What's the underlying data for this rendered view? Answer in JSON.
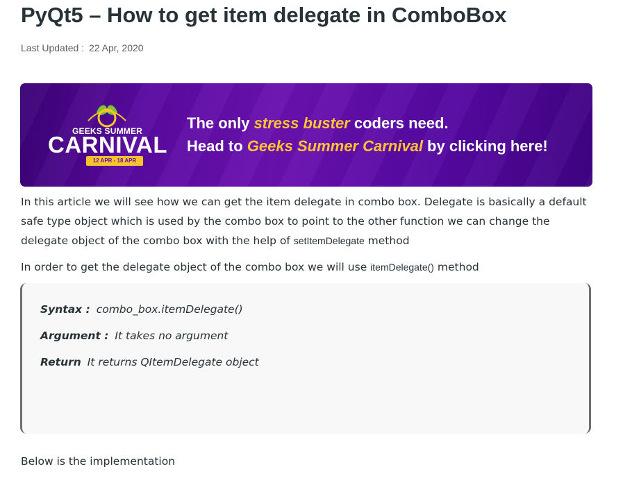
{
  "article": {
    "title": "PyQt5 – How to get item delegate in ComboBox",
    "last_updated_label": "Last Updated :",
    "last_updated_date": "22 Apr, 2020"
  },
  "banner": {
    "logo_top_text": "GEEKS SUMMER",
    "logo_main_text": "CARNIVAL",
    "logo_dates": "12 APR - 18 APR",
    "line1_prefix": "The only ",
    "line1_highlight": "stress buster",
    "line1_suffix": " coders need.",
    "line2_prefix": "Head to ",
    "line2_highlight": "Geeks Summer Carnival",
    "line2_suffix": " by clicking here!",
    "colors": {
      "background": "#5a0aa0",
      "highlight": "#ffc233",
      "text": "#ffffff"
    }
  },
  "content": {
    "intro_text": "In this article we will see how we can get the item delegate in combo box. Delegate is basically a default safe type object which is used by the combo box to point to the other function we can change the delegate object of the combo box with the help of ",
    "intro_code": "setItemDelegate",
    "intro_suffix": " method",
    "usage_text": "In order to get the delegate object of the combo box we will use ",
    "usage_code": "itemDelegate()",
    "usage_suffix": " method",
    "syntax_label": "Syntax :",
    "syntax_value": " combo_box.itemDelegate()",
    "argument_label": "Argument :",
    "argument_value": " It takes no argument",
    "return_label": "Return",
    "return_value": " It returns QItemDelegate object",
    "implementation_text": "Below is the implementation"
  }
}
